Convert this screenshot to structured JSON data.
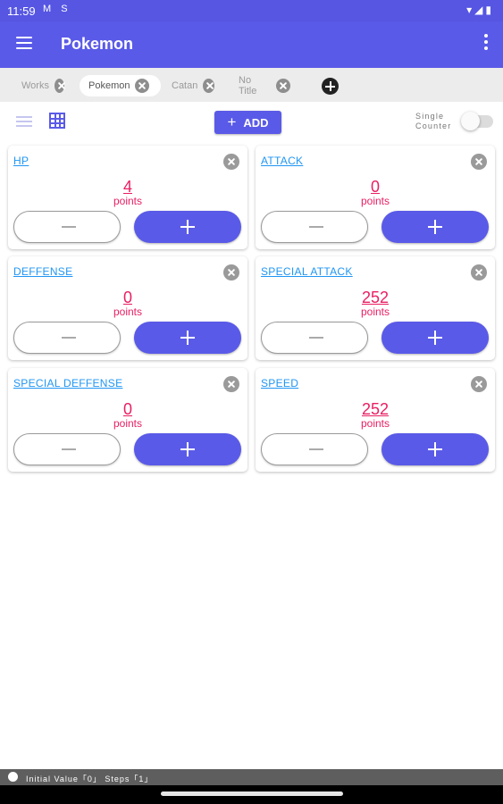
{
  "status_bar": {
    "time": "11:59",
    "left_icons": "M S",
    "right_icons": "▾◢▮"
  },
  "app_bar": {
    "title": "Pokemon"
  },
  "tabs": [
    {
      "label": "Works",
      "active": false
    },
    {
      "label": "Pokemon",
      "active": true
    },
    {
      "label": "Catan",
      "active": false
    },
    {
      "label": "No Title",
      "active": false
    }
  ],
  "toolbar": {
    "add_label": "ADD",
    "single_counter_line1": "Single",
    "single_counter_line2": "Counter",
    "single_counter_on": false
  },
  "counters": [
    {
      "name": "HP",
      "value": "4",
      "unit": "points"
    },
    {
      "name": "ATTACK",
      "value": "0",
      "unit": "points"
    },
    {
      "name": "DEFFENSE",
      "value": "0",
      "unit": "points"
    },
    {
      "name": "SPECIAL ATTACK",
      "value": "252",
      "unit": "points"
    },
    {
      "name": "SPECIAL DEFFENSE",
      "value": "0",
      "unit": "points"
    },
    {
      "name": "SPEED",
      "value": "252",
      "unit": "points"
    }
  ],
  "bottom_bar": {
    "info": "Initial Value「0」 Steps「1」"
  },
  "colors": {
    "primary": "#5a5ae8",
    "value": "#e91e63",
    "counter_name": "#2196f3"
  }
}
